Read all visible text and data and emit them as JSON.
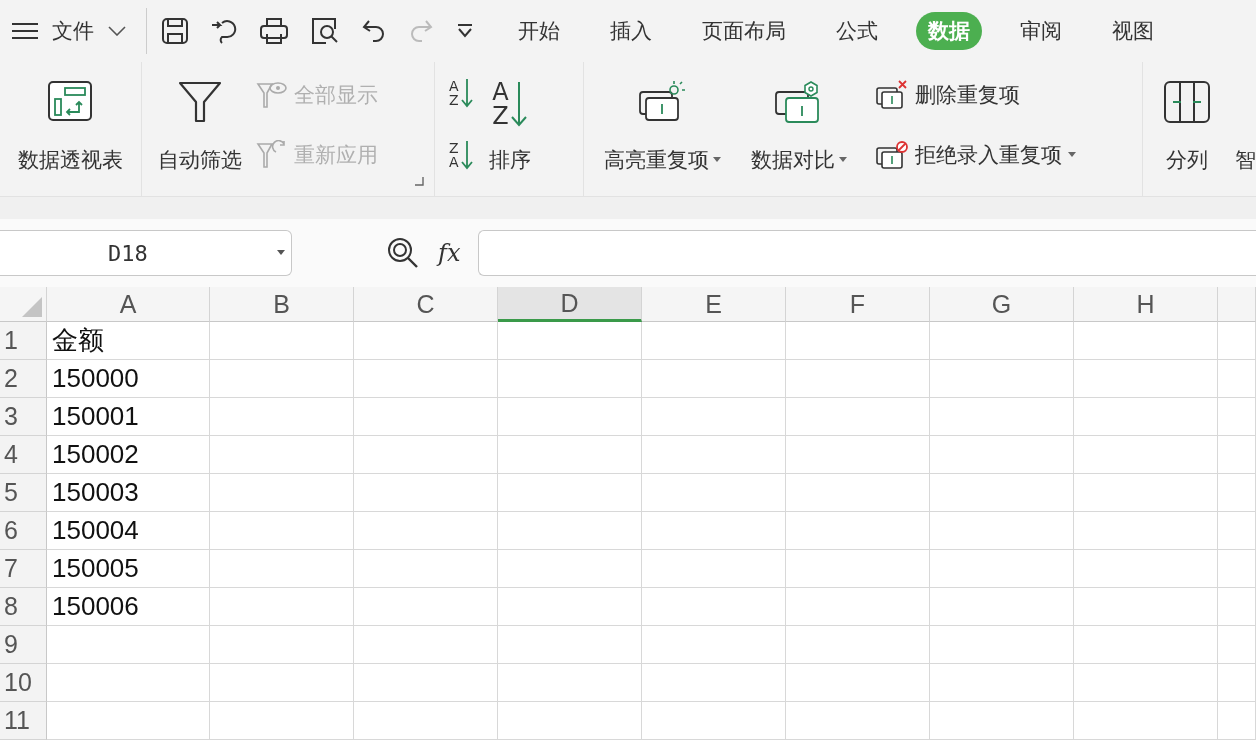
{
  "file_menu": {
    "label": "文件"
  },
  "tabs": [
    {
      "label": "开始",
      "selected": false
    },
    {
      "label": "插入",
      "selected": false
    },
    {
      "label": "页面布局",
      "selected": false
    },
    {
      "label": "公式",
      "selected": false
    },
    {
      "label": "数据",
      "selected": true
    },
    {
      "label": "审阅",
      "selected": false
    },
    {
      "label": "视图",
      "selected": false
    }
  ],
  "ribbon": {
    "pivot": {
      "label": "数据透视表",
      "disabled": false
    },
    "filter": {
      "label": "自动筛选",
      "disabled": false
    },
    "filter_small": [
      {
        "label": "全部显示",
        "disabled": true
      },
      {
        "label": "重新应用",
        "disabled": true
      }
    ],
    "sort": {
      "ascending_letters": [
        "A",
        "Z"
      ],
      "descending_letters": [
        "Z",
        "A"
      ],
      "button_letters": [
        "A",
        "Z"
      ],
      "label": "排序"
    },
    "duplicates": [
      {
        "label": "高亮重复项",
        "dropdown": true
      },
      {
        "label": "数据对比",
        "dropdown": true
      }
    ],
    "duplicates_small": [
      {
        "label": "删除重复项",
        "dropdown": false
      },
      {
        "label": "拒绝录入重复项",
        "dropdown": true
      }
    ],
    "split": {
      "label": "分列"
    },
    "cut_label": "智"
  },
  "name_box": {
    "value": "D18"
  },
  "formula_bar": {
    "fx": "fx"
  },
  "columns": [
    {
      "label": "A",
      "selected": false
    },
    {
      "label": "B",
      "selected": false
    },
    {
      "label": "C",
      "selected": false
    },
    {
      "label": "D",
      "selected": true
    },
    {
      "label": "E",
      "selected": false
    },
    {
      "label": "F",
      "selected": false
    },
    {
      "label": "G",
      "selected": false
    },
    {
      "label": "H",
      "selected": false
    }
  ],
  "rows": [
    {
      "number": "1",
      "cells": [
        "金额"
      ]
    },
    {
      "number": "2",
      "cells": [
        "150000"
      ]
    },
    {
      "number": "3",
      "cells": [
        "150001"
      ]
    },
    {
      "number": "4",
      "cells": [
        "150002"
      ]
    },
    {
      "number": "5",
      "cells": [
        "150003"
      ]
    },
    {
      "number": "6",
      "cells": [
        "150004"
      ]
    },
    {
      "number": "7",
      "cells": [
        "150005"
      ]
    },
    {
      "number": "8",
      "cells": [
        "150006"
      ]
    },
    {
      "number": "9"
    },
    {
      "number": "10"
    },
    {
      "number": "11"
    }
  ]
}
